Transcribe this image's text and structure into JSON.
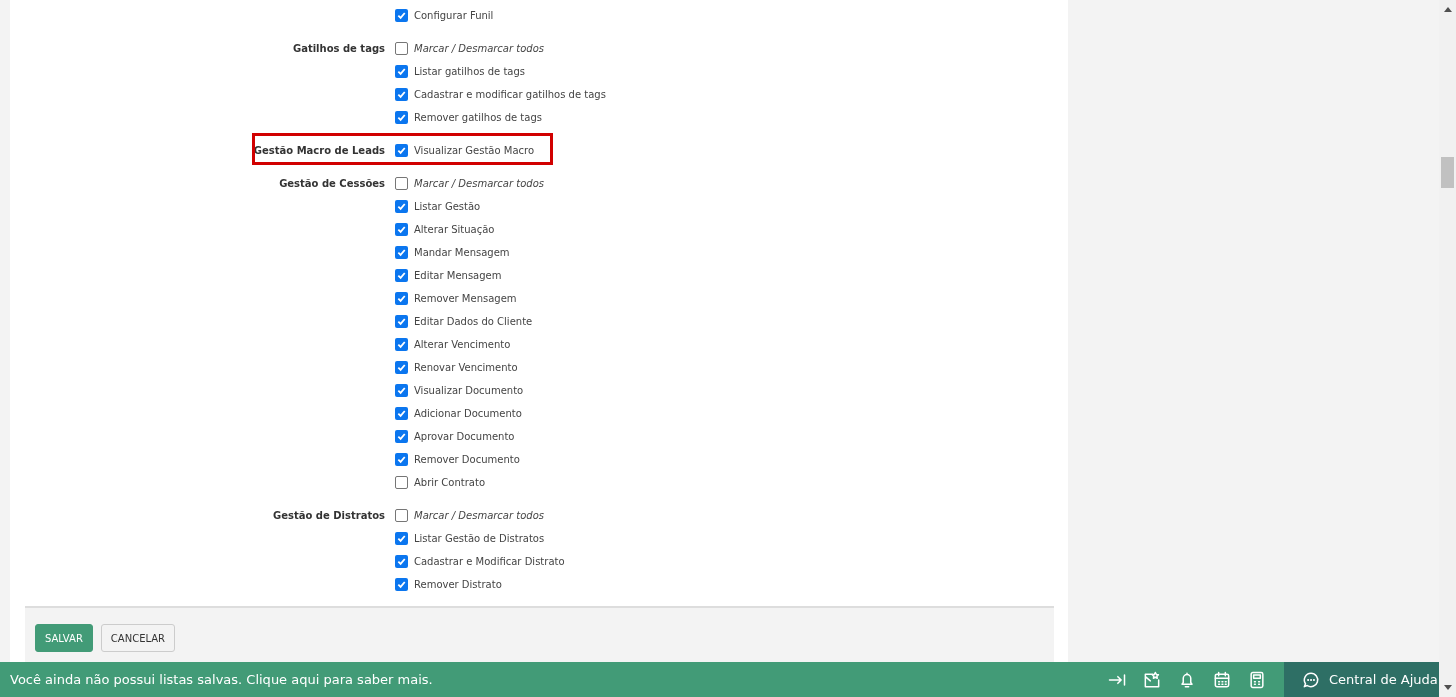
{
  "groups": [
    {
      "highlighted": false,
      "items": [
        {
          "kind": "permission",
          "text": "Configurar Funil",
          "checked": true
        }
      ]
    },
    {
      "label": "Gatilhos de tags",
      "highlighted": false,
      "items": [
        {
          "kind": "toggle-all",
          "text": "Marcar / Desmarcar todos",
          "checked": false
        },
        {
          "kind": "permission",
          "text": "Listar gatilhos de tags",
          "checked": true
        },
        {
          "kind": "permission",
          "text": "Cadastrar e modificar gatilhos de tags",
          "checked": true
        },
        {
          "kind": "permission",
          "text": "Remover gatilhos de tags",
          "checked": true
        }
      ]
    },
    {
      "label": "Gestão Macro de Leads",
      "highlighted": true,
      "items": [
        {
          "kind": "permission",
          "text": "Visualizar Gestão Macro",
          "checked": true
        }
      ]
    },
    {
      "label": "Gestão de Cessões",
      "highlighted": false,
      "items": [
        {
          "kind": "toggle-all",
          "text": "Marcar / Desmarcar todos",
          "checked": false
        },
        {
          "kind": "permission",
          "text": "Listar Gestão",
          "checked": true
        },
        {
          "kind": "permission",
          "text": "Alterar Situação",
          "checked": true
        },
        {
          "kind": "permission",
          "text": "Mandar Mensagem",
          "checked": true
        },
        {
          "kind": "permission",
          "text": "Editar Mensagem",
          "checked": true
        },
        {
          "kind": "permission",
          "text": "Remover Mensagem",
          "checked": true
        },
        {
          "kind": "permission",
          "text": "Editar Dados do Cliente",
          "checked": true
        },
        {
          "kind": "permission",
          "text": "Alterar Vencimento",
          "checked": true
        },
        {
          "kind": "permission",
          "text": "Renovar Vencimento",
          "checked": true
        },
        {
          "kind": "permission",
          "text": "Visualizar Documento",
          "checked": true
        },
        {
          "kind": "permission",
          "text": "Adicionar Documento",
          "checked": true
        },
        {
          "kind": "permission",
          "text": "Aprovar Documento",
          "checked": true
        },
        {
          "kind": "permission",
          "text": "Remover Documento",
          "checked": true
        },
        {
          "kind": "permission",
          "text": "Abrir Contrato",
          "checked": false
        }
      ]
    },
    {
      "label": "Gestão de Distratos",
      "highlighted": false,
      "items": [
        {
          "kind": "toggle-all",
          "text": "Marcar / Desmarcar todos",
          "checked": false
        },
        {
          "kind": "permission",
          "text": "Listar Gestão de Distratos",
          "checked": true
        },
        {
          "kind": "permission",
          "text": "Cadastrar e Modificar Distrato",
          "checked": true
        },
        {
          "kind": "permission",
          "text": "Remover Distrato",
          "checked": true
        }
      ]
    }
  ],
  "buttons": [
    {
      "label": "SALVAR",
      "kind": "primary"
    },
    {
      "label": "CANCELAR",
      "kind": "secondary"
    }
  ],
  "bottom_bar": {
    "message": "Você ainda não possui listas salvas. Clique aqui para saber mais.",
    "help_label": "Central de Ajuda"
  }
}
